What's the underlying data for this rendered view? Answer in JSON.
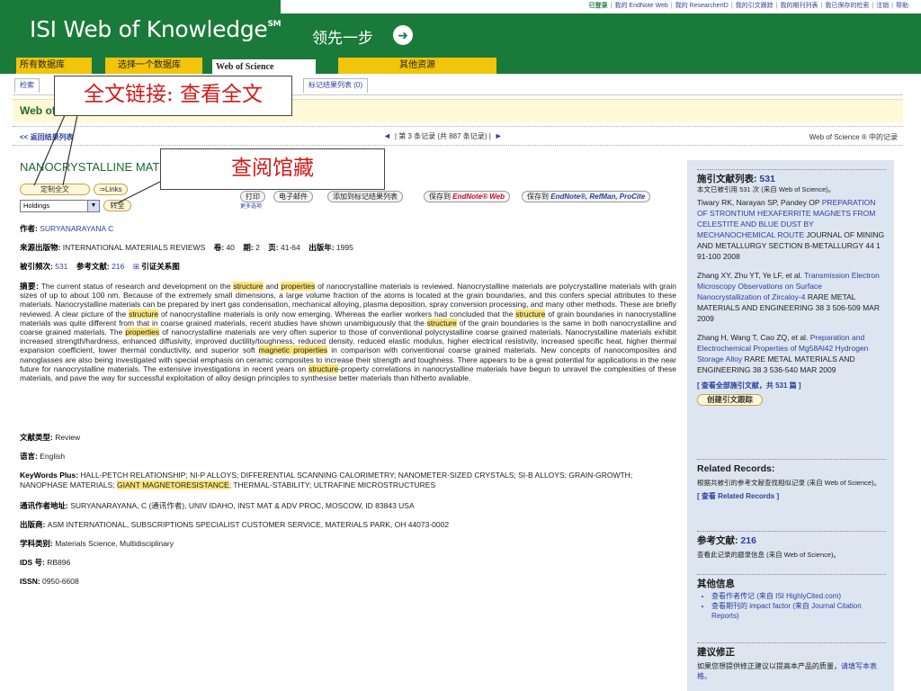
{
  "top_links": [
    "已登录",
    "我的 EndNote Web",
    "我的 ResearcherID",
    "我的引文跟踪",
    "我的期刊列表",
    "我已保存的检索",
    "注销",
    "帮助"
  ],
  "brand": {
    "name": "ISI Web of Knowledge",
    "mark": "SM",
    "slogan": "领先一步"
  },
  "tabs": [
    "所有数据库",
    "选择一个数据库",
    "Web of Science",
    "其他资源"
  ],
  "subtabs": {
    "search": "检索",
    "marked_list": "标记结果列表 (0)"
  },
  "section_title": "Web of Science",
  "nav": {
    "back": "<< 返回结果列表",
    "record_position": "第 3 条记录 (共 887 条记录)",
    "prev_glyph": "◄",
    "next_glyph": "►",
    "right_label": "Web of Science ® 中的记录"
  },
  "record": {
    "title": "NANOCRYSTALLINE MATERIALS",
    "fulltext_btn": "定制全文",
    "links_btn": "⇒Links",
    "holdings_select": "Holdings",
    "go_btn": "转至",
    "actions": {
      "print": "打印",
      "email": "电子邮件",
      "add_marked": "添加到标记结果列表",
      "save_to": "保存到",
      "save_endnote_web": "EndNote® Web",
      "save_refs": "EndNote®, RefMan, ProCite"
    },
    "more_options": "更多选项",
    "author_label": "作者:",
    "author": "SURYANARAYANA C",
    "source_label": "来源出版物:",
    "source": "INTERNATIONAL MATERIALS REVIEWS",
    "volume_label": "卷:",
    "volume": "40",
    "issue_label": "期:",
    "issue": "2",
    "pages_label": "页:",
    "pages": "41-64",
    "year_label": "出版年:",
    "year": "1995",
    "times_cited_label": "被引频次:",
    "times_cited": "531",
    "refs_label": "参考文献:",
    "refs": "216",
    "citation_map": "引证关系图",
    "abstract_label": "摘要:",
    "abstract_parts": [
      "The current status of research and development on the ",
      "structure",
      " and ",
      "properties",
      " of nanocrystalline materials is reviewed. Nanocrystalline materials are polycrystalline materials with grain sizes of up to about 100 nm. Because of the extremely small dimensions, a large volume fraction of the atoms is located at the grain boundaries, and this confers special attributes to these materials. Nanocrystalline materials can be prepared by inert gas condensation, mechanical alloying, plasma deposition, spray conversion processing, and many other methods. These are briefly reviewed. A clear picture of the ",
      "structure",
      " of nanocrystalline materials is only now emerging. Whereas the earlier workers had concluded that the ",
      "structure",
      " of grain boundaries in nanocrystalline materials was quite different from that in coarse grained materials, recent studies have shown unambiguously that the ",
      "structure",
      " of the grain boundaries is the same in both nanocrystalline and coarse grained materials. The ",
      "properties",
      " of nanocrystalline materials are very often superior to those of conventional polycrystalline coarse grained materials. Nanocrystalline materials exhibit increased strength/hardness, enhanced diffusivity, improved ductility/toughness, reduced density, reduced elastic modulus, higher electrical resistivity, increased specific heat, higher thermal expansion coefficient, lower thermal conductivity, and superior soft ",
      "magnetic properties",
      " in comparison with conventional coarse grained materials. New concepts of nanocomposites and nanoglasses are also being investigated with special emphasis on ceramic composites to increase their strength and toughness. There appears to be a great potential for applications in the near future for nanocrystalline materials. The extensive investigations in recent years on ",
      "structure",
      "-property correlations in nanocrystalline materials have begun to unravel the complexities of these materials, and pave the way for successful exploitation of alloy design principles to synthesise better materials than hitherto available."
    ],
    "doctype_label": "文献类型:",
    "doctype": "Review",
    "language_label": "语言:",
    "language": "English",
    "keywords_label": "KeyWords Plus:",
    "keywords_parts": [
      "HALL-PETCH RELATIONSHIP; NI-P ALLOYS; DIFFERENTIAL SCANNING CALORIMETRY; NANOMETER-SIZED CRYSTALS; SI-B ALLOYS; GRAIN-GROWTH; NANOPHASE MATERIALS; ",
      "GIANT MAGNETORESISTANCE",
      "; THERMAL-STABILITY; ULTRAFINE MICROSTRUCTURES"
    ],
    "address_label": "通讯作者地址:",
    "address": "SURYANARAYANA, C (通讯作者), UNIV IDAHO, INST MAT & ADV PROC, MOSCOW, ID 83843 USA",
    "publisher_label": "出版商:",
    "publisher": "ASM INTERNATIONAL, SUBSCRIPTIONS SPECIALIST CUSTOMER SERVICE, MATERIALS PARK, OH 44073-0002",
    "category_label": "学科类别:",
    "category": "Materials Science, Multidisciplinary",
    "ids_label": "IDS 号:",
    "ids": "RB896",
    "issn_label": "ISSN:",
    "issn": "0950-6608"
  },
  "sidebar": {
    "cited_title": "施引文献列表:",
    "cited_count": "531",
    "cited_desc": "本文已被引用 531 次 (来自 Web of Science)。",
    "citations": [
      {
        "authors": "Tiwary RK, Narayan SP, Pandey OP",
        "title": "PREPARATION OF STRONTIUM HEXAFERRITE MAGNETS FROM CELESTITE AND BLUE DUST BY MECHANOCHEMICAL ROUTE",
        "source": "JOURNAL OF MINING AND METALLURGY SECTION B-METALLURGY 44 1 91-100 2008"
      },
      {
        "authors": "Zhang XY, Zhu YT, Ye LF, et al.",
        "title": "Transmission Electron Microscopy Observations on Surface Nanocrystallization of Zircaloy-4",
        "source": "RARE METAL MATERIALS AND ENGINEERING 38 3 506-509 MAR 2009"
      },
      {
        "authors": "Zhang H, Wang T, Cao ZQ, et al.",
        "title": "Preparation and Electrochemical Properties of Mg58Al42 Hydrogen Storage Alloy",
        "source": "RARE METAL MATERIALS AND ENGINEERING 38 3 536-540 MAR 2009"
      }
    ],
    "view_all": "[ 查看全部施引文献，共 531 篇 ]",
    "create_alert": "创建引文跟踪",
    "related_title": "Related Records:",
    "related_desc": "根据共被引的参考文献查找相似记录 (来自 Web of Science)。",
    "related_link": "[ 查看 Related Records ]",
    "refs_title": "参考文献:",
    "refs_count": "216",
    "refs_desc": "查看此记录的题录信息 (来自 Web of Science)。",
    "other_title": "其他信息",
    "other_links": [
      "查看作者传记 (来自 ISI HighlyCited.com)",
      "查看期刊的 impact factor (来自 Journal Citation Reports)"
    ],
    "suggest_title": "建议修正",
    "suggest_desc": "如果您想提供修正建议以提高本产品的质量，",
    "suggest_link": "请填写本表格。"
  },
  "annotations": {
    "fulltext": "全文链接: 查看全文",
    "holdings": "查阅馆藏"
  },
  "colors": {
    "brand_green": "#1a7a3a",
    "tab_yellow": "#f2c40a",
    "link_blue": "#2b3fa0",
    "highlight": "#fde57a",
    "callout_red": "#d21a1a"
  }
}
